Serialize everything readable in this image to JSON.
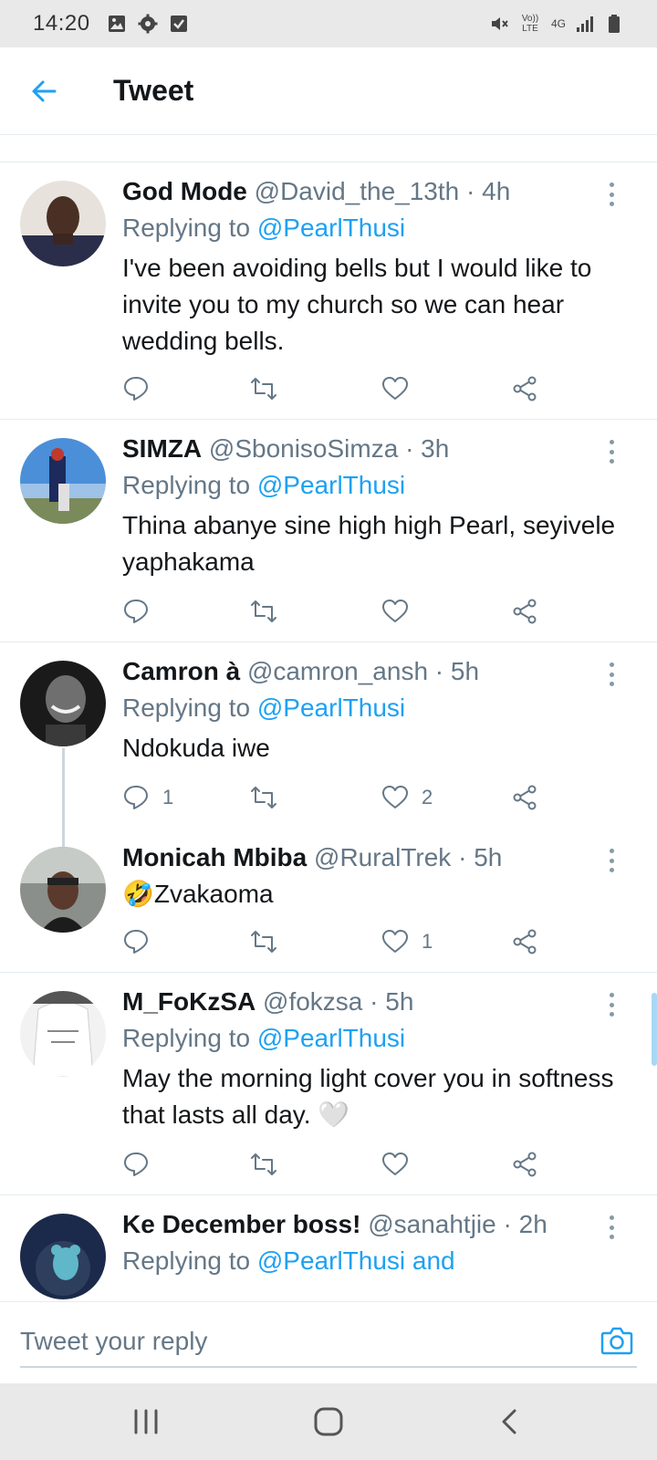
{
  "status_bar": {
    "time": "14:20",
    "left_icons": [
      "image-icon",
      "gear-icon",
      "checkbox-icon"
    ],
    "right_icons": [
      "mute-icon",
      "volte-icon",
      "4g-icon",
      "signal-icon",
      "battery-icon"
    ],
    "volte_label": "Vo)) LTE",
    "network_label": "4G"
  },
  "header": {
    "title": "Tweet"
  },
  "colors": {
    "accent": "#1da1f2",
    "text": "#14171a",
    "muted": "#657786"
  },
  "tweets": [
    {
      "name": "God Mode",
      "handle": "@David_the_13th",
      "time": "· 4h",
      "replying_label": "Replying to",
      "replying_to": "@PearlThusi",
      "text": "I've been avoiding bells but I would like to invite you to my church so we can hear wedding bells.",
      "reply_count": "",
      "like_count": ""
    },
    {
      "name": "SIMZA",
      "handle": "@SbonisoSimza",
      "time": "· 3h",
      "replying_label": "Replying to",
      "replying_to": "@PearlThusi",
      "text": "Thina abanye sine high high Pearl, seyivele yaphakama",
      "reply_count": "",
      "like_count": ""
    },
    {
      "name": "Camron à",
      "handle": "@camron_ansh",
      "time": "· 5h",
      "replying_label": "Replying to",
      "replying_to": "@PearlThusi",
      "text": "Ndokuda iwe",
      "reply_count": "1",
      "like_count": "2"
    },
    {
      "name": "Monicah Mbiba",
      "handle": "@RuralTrek",
      "time": "· 5h",
      "emoji": "🤣",
      "text": "Zvakaoma",
      "reply_count": "",
      "like_count": "1"
    },
    {
      "name": "M_FoKzSA",
      "handle": "@fokzsa",
      "time": "· 5h",
      "replying_label": "Replying to",
      "replying_to": "@PearlThusi",
      "text": "May the morning light cover you in softness that lasts all day.",
      "emoji_end": "🤍",
      "reply_count": "",
      "like_count": ""
    },
    {
      "name": "Ke December boss!",
      "handle": "@sanahtjie",
      "time": "· 2h",
      "replying_label": "Replying to",
      "replying_to": "@PearlThusi and"
    }
  ],
  "reply_bar": {
    "placeholder": "Tweet your reply"
  }
}
